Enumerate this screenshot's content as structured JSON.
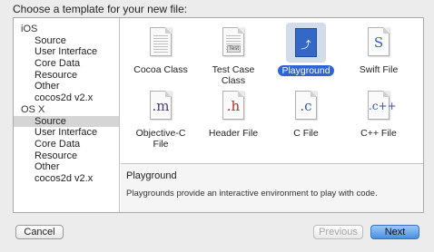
{
  "dialog": {
    "title": "Choose a template for your new file:"
  },
  "sidebar": {
    "groups": [
      {
        "name": "iOS",
        "items": [
          "Source",
          "User Interface",
          "Core Data",
          "Resource",
          "Other",
          "cocos2d v2.x"
        ]
      },
      {
        "name": "OS X",
        "items": [
          "Source",
          "User Interface",
          "Core Data",
          "Resource",
          "Other",
          "cocos2d v2.x"
        ]
      }
    ],
    "selected": "OS X / Source"
  },
  "templates": [
    {
      "label": "Cocoa Class",
      "icon": "objc-class-doc-icon"
    },
    {
      "label": "Test Case Class",
      "icon": "test-case-doc-icon",
      "badge": "Test"
    },
    {
      "label": "Playground",
      "icon": "playground-icon",
      "selected": true
    },
    {
      "label": "Swift File",
      "icon": "swift-doc-icon",
      "glyph": "S"
    },
    {
      "label": "Objective-C File",
      "icon": "objc-file-doc-icon",
      "glyph": ".m"
    },
    {
      "label": "Header File",
      "icon": "header-doc-icon",
      "glyph": ".h"
    },
    {
      "label": "C File",
      "icon": "c-doc-icon",
      "glyph": ".c"
    },
    {
      "label": "C++ File",
      "icon": "cpp-doc-icon",
      "glyph": ".c++"
    }
  ],
  "description": {
    "title": "Playground",
    "text": "Playgrounds provide an interactive environment to play with code."
  },
  "buttons": {
    "cancel": "Cancel",
    "previous": "Previous",
    "next": "Next"
  },
  "colors": {
    "selection": "#2f64d6",
    "primary_button": "#4a8fe0"
  }
}
